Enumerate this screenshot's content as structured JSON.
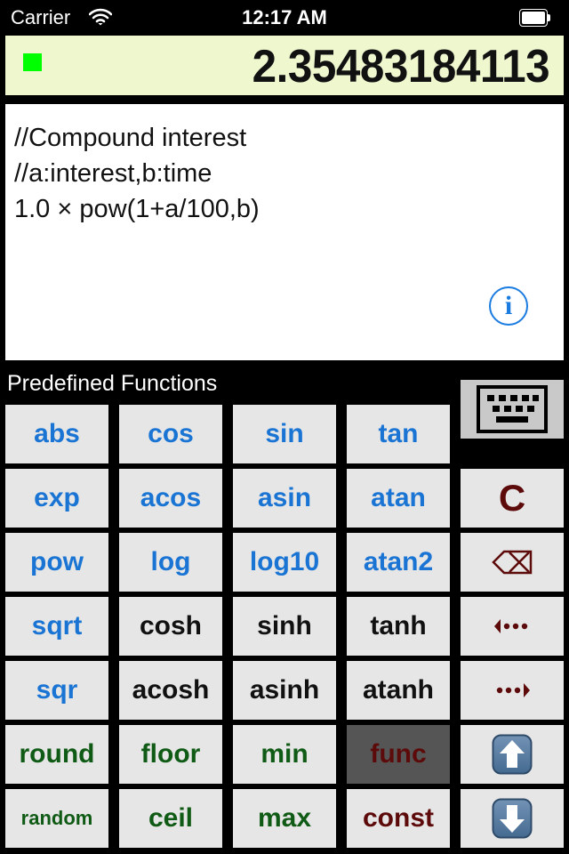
{
  "status_bar": {
    "carrier": "Carrier",
    "wifi_icon": "wifi-icon",
    "time": "12:17 AM",
    "battery_icon": "battery-full-icon"
  },
  "display": {
    "status_led_color": "#00ff00",
    "result": "2.35483184113",
    "background": "#eff7cf"
  },
  "editor": {
    "lines": [
      "//Compound interest",
      "//a:interest,b:time",
      "1.0 × pow(1+a/100,b)"
    ],
    "info_button": "i"
  },
  "section_label": "Predefined Functions",
  "keyboard_button": {
    "icon": "keyboard-icon"
  },
  "colors": {
    "blue": "#1a74d4",
    "green": "#0f5a14",
    "dark_red": "#5c0a0a",
    "button_bg": "#e6e6e6",
    "selected_bg": "#555555"
  },
  "function_grid": {
    "rows": [
      [
        "abs",
        "cos",
        "sin",
        "tan"
      ],
      [
        "exp",
        "acos",
        "asin",
        "atan"
      ],
      [
        "pow",
        "log",
        "log10",
        "atan2"
      ],
      [
        "sqrt",
        "cosh",
        "sinh",
        "tanh"
      ],
      [
        "sqr",
        "acosh",
        "asinh",
        "atanh"
      ],
      [
        "round",
        "floor",
        "min",
        "func"
      ],
      [
        "random",
        "ceil",
        "max",
        "const"
      ]
    ],
    "selected": "func"
  },
  "side_controls": {
    "clear": "C",
    "backspace_icon": "backspace-icon",
    "cursor_left_icon": "cursor-left-icon",
    "cursor_right_icon": "cursor-right-icon",
    "page_up_icon": "arrow-up-icon",
    "page_down_icon": "arrow-down-icon"
  }
}
